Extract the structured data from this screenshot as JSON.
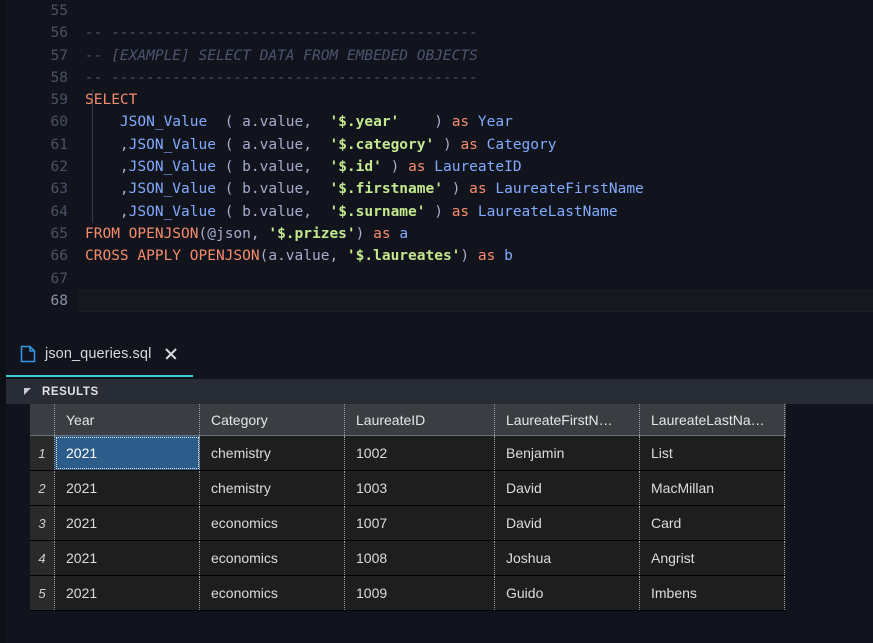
{
  "editor": {
    "language": "sql",
    "active_line": 68,
    "lines": [
      {
        "num": "55",
        "active": false,
        "tokens": []
      },
      {
        "num": "56",
        "active": false,
        "tokens": [
          {
            "t": "comment",
            "s": "-- ------------------------------------------"
          }
        ]
      },
      {
        "num": "57",
        "active": false,
        "tokens": [
          {
            "t": "comment",
            "s": "-- [EXAMPLE] SELECT DATA FROM EMBEDED OBJECTS"
          }
        ]
      },
      {
        "num": "58",
        "active": false,
        "tokens": [
          {
            "t": "comment",
            "s": "-- ------------------------------------------"
          }
        ]
      },
      {
        "num": "59",
        "active": false,
        "tokens": [
          {
            "t": "kw",
            "s": "SELECT"
          }
        ]
      },
      {
        "num": "60",
        "active": false,
        "tokens": [
          {
            "t": "plain",
            "s": "    "
          },
          {
            "t": "fn",
            "s": "JSON_Value"
          },
          {
            "t": "plain",
            "s": "  ( a.value,  "
          },
          {
            "t": "str",
            "s": "'$.year'"
          },
          {
            "t": "plain",
            "s": "    ) "
          },
          {
            "t": "kw",
            "s": "as"
          },
          {
            "t": "plain",
            "s": " "
          },
          {
            "t": "id",
            "s": "Year"
          }
        ]
      },
      {
        "num": "61",
        "active": false,
        "tokens": [
          {
            "t": "plain",
            "s": "    ,"
          },
          {
            "t": "fn",
            "s": "JSON_Value"
          },
          {
            "t": "plain",
            "s": " ( a.value,  "
          },
          {
            "t": "str",
            "s": "'$.category'"
          },
          {
            "t": "plain",
            "s": " ) "
          },
          {
            "t": "kw",
            "s": "as"
          },
          {
            "t": "plain",
            "s": " "
          },
          {
            "t": "id",
            "s": "Category"
          }
        ]
      },
      {
        "num": "62",
        "active": false,
        "tokens": [
          {
            "t": "plain",
            "s": "    ,"
          },
          {
            "t": "fn",
            "s": "JSON_Value"
          },
          {
            "t": "plain",
            "s": " ( b.value,  "
          },
          {
            "t": "str",
            "s": "'$.id'"
          },
          {
            "t": "plain",
            "s": " ) "
          },
          {
            "t": "kw",
            "s": "as"
          },
          {
            "t": "plain",
            "s": " "
          },
          {
            "t": "id",
            "s": "LaureateID"
          }
        ]
      },
      {
        "num": "63",
        "active": false,
        "tokens": [
          {
            "t": "plain",
            "s": "    ,"
          },
          {
            "t": "fn",
            "s": "JSON_Value"
          },
          {
            "t": "plain",
            "s": " ( b.value,  "
          },
          {
            "t": "str",
            "s": "'$.firstname'"
          },
          {
            "t": "plain",
            "s": " ) "
          },
          {
            "t": "kw",
            "s": "as"
          },
          {
            "t": "plain",
            "s": " "
          },
          {
            "t": "id",
            "s": "LaureateFirstName"
          }
        ]
      },
      {
        "num": "64",
        "active": false,
        "tokens": [
          {
            "t": "plain",
            "s": "    ,"
          },
          {
            "t": "fn",
            "s": "JSON_Value"
          },
          {
            "t": "plain",
            "s": " ( b.value,  "
          },
          {
            "t": "str",
            "s": "'$.surname'"
          },
          {
            "t": "plain",
            "s": " ) "
          },
          {
            "t": "kw",
            "s": "as"
          },
          {
            "t": "plain",
            "s": " "
          },
          {
            "t": "id",
            "s": "LaureateLastName"
          }
        ]
      },
      {
        "num": "65",
        "active": false,
        "tokens": [
          {
            "t": "kw",
            "s": "FROM OPENJSON"
          },
          {
            "t": "plain",
            "s": "(@json, "
          },
          {
            "t": "str",
            "s": "'$.prizes'"
          },
          {
            "t": "plain",
            "s": ") "
          },
          {
            "t": "kw",
            "s": "as"
          },
          {
            "t": "plain",
            "s": " "
          },
          {
            "t": "id",
            "s": "a"
          }
        ]
      },
      {
        "num": "66",
        "active": false,
        "tokens": [
          {
            "t": "kw",
            "s": "CROSS APPLY OPENJSON"
          },
          {
            "t": "plain",
            "s": "(a.value, "
          },
          {
            "t": "str",
            "s": "'$.laureates'"
          },
          {
            "t": "plain",
            "s": ") "
          },
          {
            "t": "kw",
            "s": "as"
          },
          {
            "t": "plain",
            "s": " "
          },
          {
            "t": "id",
            "s": "b"
          }
        ]
      },
      {
        "num": "67",
        "active": false,
        "tokens": []
      },
      {
        "num": "68",
        "active": true,
        "tokens": []
      }
    ]
  },
  "tab": {
    "icon": "file-sql-icon",
    "label": "json_queries.sql",
    "close_icon": "close-icon",
    "active": true,
    "accent_color": "#3ecfcf"
  },
  "results": {
    "caret_icon": "collapse-caret-icon",
    "title": "RESULTS",
    "columns": [
      "Year",
      "Category",
      "LaureateID",
      "LaureateFirstN…",
      "LaureateLastNa…"
    ],
    "selected_cell": {
      "row": 0,
      "col": 0
    },
    "selection_color": "#2b5c8a",
    "rows": [
      {
        "n": "1",
        "cells": [
          "2021",
          "chemistry",
          "1002",
          "Benjamin",
          "List"
        ]
      },
      {
        "n": "2",
        "cells": [
          "2021",
          "chemistry",
          "1003",
          "David",
          "MacMillan"
        ]
      },
      {
        "n": "3",
        "cells": [
          "2021",
          "economics",
          "1007",
          "David",
          "Card"
        ]
      },
      {
        "n": "4",
        "cells": [
          "2021",
          "economics",
          "1008",
          "Joshua",
          "Angrist"
        ]
      },
      {
        "n": "5",
        "cells": [
          "2021",
          "economics",
          "1009",
          "Guido",
          "Imbens"
        ]
      }
    ]
  }
}
